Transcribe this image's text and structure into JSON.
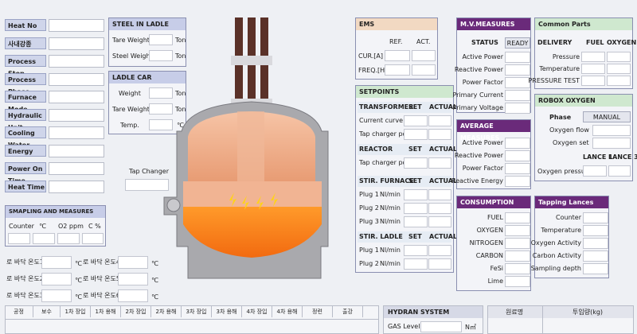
{
  "left_fields": [
    "Heat No",
    "사내강종",
    "Process Step",
    "Process Phase",
    "Furnace Mode",
    "Hydraulic Unit",
    "Cooling Water",
    "Energy",
    "Power On Time",
    "Heat Time"
  ],
  "steel_in_ladle": {
    "title": "STEEL IN LADLE",
    "rows": [
      {
        "label": "Tare Weight",
        "unit": "Ton"
      },
      {
        "label": "Steel Weight",
        "unit": "Ton"
      }
    ]
  },
  "ladle_car": {
    "title": "LADLE CAR",
    "rows": [
      {
        "label": "Weight",
        "unit": "Ton"
      },
      {
        "label": "Tare Weight",
        "unit": "Ton"
      },
      {
        "label": "Temp.",
        "unit": "℃"
      }
    ]
  },
  "tap_changer": {
    "label": "Tap Changer"
  },
  "sampling": {
    "title": "SMAPLING AND MEASURES",
    "headers": [
      "Counter",
      "℃",
      "O2 ppm",
      "C %"
    ]
  },
  "temps": [
    {
      "label": "로 바닥 온도1",
      "unit": "℃"
    },
    {
      "label": "로 바닥 온도4",
      "unit": "℃"
    },
    {
      "label": "로 바닥 온도2",
      "unit": "℃"
    },
    {
      "label": "로 바닥 온도5",
      "unit": "℃"
    },
    {
      "label": "로 바닥 온도3",
      "unit": "℃"
    },
    {
      "label": "로 바닥 온도6",
      "unit": "℃"
    }
  ],
  "ems": {
    "title": "EMS",
    "ref": "REF.",
    "act": "ACT.",
    "rows": [
      "CUR.[A]",
      "FREQ.[Hz]"
    ]
  },
  "setpoints": {
    "title": "SETPOINTS",
    "transformer": {
      "label": "TRANSFORMER",
      "set": "SET",
      "actual": "ACTUAL",
      "rows": [
        "Current curve",
        "Tap charger pos."
      ]
    },
    "reactor": {
      "label": "REACTOR",
      "set": "SET",
      "actual": "ACTUAL",
      "rows": [
        "Tap charger pos."
      ]
    },
    "stir_furnace": {
      "label": "STIR. FURNACE",
      "set": "SET",
      "actual": "ACTUAL",
      "rows": [
        {
          "label": "Plug 1",
          "unit": "Nl/min"
        },
        {
          "label": "Plug 2",
          "unit": "Nl/min"
        },
        {
          "label": "Plug 3",
          "unit": "Nl/min"
        }
      ]
    },
    "stir_ladle": {
      "label": "STIR. LADLE",
      "set": "SET",
      "actual": "ACTUAL",
      "rows": [
        {
          "label": "Plug 1",
          "unit": "Nl/min"
        },
        {
          "label": "Plug 2",
          "unit": "Nl/min"
        }
      ]
    }
  },
  "mv_measures": {
    "title": "M.V.MEASURES",
    "status_label": "STATUS",
    "status_value": "READY",
    "rows": [
      "Active Power",
      "Reactive Power",
      "Power Factor",
      "Primary Current",
      "Primary Voltage"
    ]
  },
  "average_measures": {
    "title": "AVERAGE MEASURES",
    "rows": [
      "Active Power",
      "Reactive Power",
      "Power Factor",
      "Reactive Energy"
    ]
  },
  "consumption": {
    "title": "CONSUMPTION",
    "rows": [
      "FUEL",
      "OXYGEN",
      "NITROGEN",
      "CARBON",
      "FeSi",
      "Lime"
    ]
  },
  "common_parts": {
    "title": "Common Parts",
    "headers": [
      "DELIVERY",
      "FUEL",
      "OXYGEN"
    ],
    "rows": [
      "Pressure",
      "Temperature",
      "PRESSURE TEST"
    ]
  },
  "robox_oxygen": {
    "title": "ROBOX OXYGEN",
    "phase_label": "Phase",
    "phase_value": "MANUAL",
    "rows": [
      "Oxygen flow",
      "Oxygen set"
    ],
    "lance1": "LANCE 1",
    "lance3": "LANCE 3",
    "pressure": "Oxygen pressure"
  },
  "tapping_lances": {
    "title": "Tapping Lances",
    "rows": [
      "Counter",
      "Temperature",
      "Oxygen Activity",
      "Carbon Activity",
      "Sampling depth"
    ]
  },
  "bottom_table": {
    "headers": [
      "공정",
      "보수",
      "1차 장입",
      "1차 용해",
      "2차 장입",
      "2차 용해",
      "3차 장입",
      "3차 용해",
      "4차 장입",
      "4차 용해",
      "정련",
      "출강"
    ]
  },
  "hydran": {
    "title": "HYDRAN SYSTEM",
    "gas_label": "GAS Level",
    "gas_unit": "N㎥"
  },
  "bottom_right": {
    "headers": [
      "원료명",
      "투입량(kg)"
    ]
  }
}
